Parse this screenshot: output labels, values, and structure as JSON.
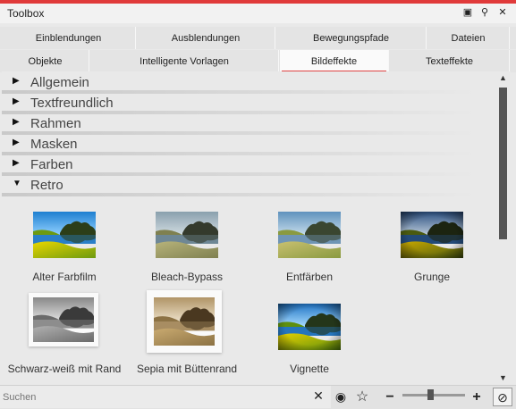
{
  "colors": {
    "accent": "#e04444",
    "top_line": "#e03a3a"
  },
  "window": {
    "title": "Toolbox",
    "buttons": [
      {
        "name": "restore-icon",
        "glyph": "▣"
      },
      {
        "name": "pin-icon",
        "glyph": "⚲"
      },
      {
        "name": "close-icon",
        "glyph": "✕"
      }
    ]
  },
  "tabs_row1": [
    {
      "label": "Einblendungen"
    },
    {
      "label": "Ausblendungen"
    },
    {
      "label": "Bewegungspfade"
    },
    {
      "label": "Dateien"
    }
  ],
  "tabs_row2": [
    {
      "label": "Objekte"
    },
    {
      "label": "Intelligente Vorlagen"
    },
    {
      "label": "Bildeffekte",
      "active": true
    },
    {
      "label": "Texteffekte"
    }
  ],
  "sections": [
    {
      "label": "Allgemein",
      "expanded": false
    },
    {
      "label": "Textfreundlich",
      "expanded": false
    },
    {
      "label": "Rahmen",
      "expanded": false
    },
    {
      "label": "Masken",
      "expanded": false
    },
    {
      "label": "Farben",
      "expanded": false
    },
    {
      "label": "Retro",
      "expanded": true
    }
  ],
  "retro_items": [
    {
      "label": "Alter Farbfilm",
      "style": "vivid"
    },
    {
      "label": "Bleach-Bypass",
      "style": "bleach"
    },
    {
      "label": "Entfärben",
      "style": "desat"
    },
    {
      "label": "Grunge",
      "style": "grunge"
    },
    {
      "label": "Schwarz-weiß mit Rand",
      "style": "bw-frame"
    },
    {
      "label": "Sepia mit Büttenrand",
      "style": "sepia-frame"
    },
    {
      "label": "Vignette",
      "style": "vignette"
    }
  ],
  "bottom": {
    "search_placeholder": "Suchen",
    "clear_glyph": "✕",
    "eye_glyph": "◉",
    "star_glyph": "☆",
    "minus_glyph": "−",
    "plus_glyph": "+",
    "zoom_glyph": "⊘",
    "zoom_level": 0.45
  }
}
